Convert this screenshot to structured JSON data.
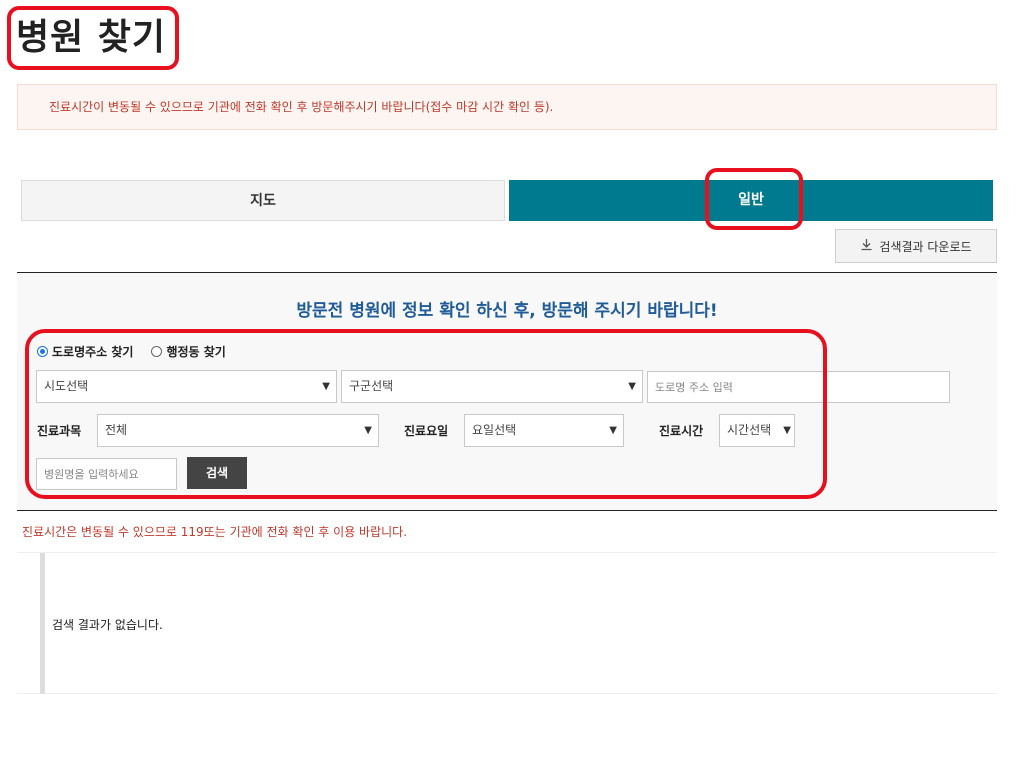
{
  "page": {
    "title": "병원 찾기",
    "notice": "진료시간이 변동될 수 있으므로 기관에 전화 확인 후 방문해주시기 바랍니다(접수 마감 시간 확인 등)."
  },
  "tabs": [
    {
      "label": "지도",
      "active": false
    },
    {
      "label": "일반",
      "active": true
    }
  ],
  "download": {
    "label": "검색결과 다운로드",
    "icon": "download-icon"
  },
  "search": {
    "heading": "방문전 병원에 정보 확인 하신 후, 방문해 주시기 바랍니다!",
    "radios": [
      {
        "label": "도로명주소 찾기",
        "checked": true
      },
      {
        "label": "행정동 찾기",
        "checked": false
      }
    ],
    "sido": "시도선택",
    "gugun": "구군선택",
    "road_placeholder": "도로명 주소 입력",
    "dept_label": "진료과목",
    "dept_value": "전체",
    "day_label": "진료요일",
    "day_value": "요일선택",
    "time_label": "진료시간",
    "time_value": "시간선택",
    "name_placeholder": "병원명을 입력하세요",
    "button": "검색"
  },
  "warning": "진료시간은 변동될 수 있으므로 119또는 기관에 전화 확인 후 이용 바랍니다.",
  "results": {
    "empty": "검색 결과가 없습니다."
  },
  "colors": {
    "accent": "#007a8f",
    "highlight": "#e8101f",
    "heading": "#1f5c99",
    "warn": "#c0392b"
  }
}
